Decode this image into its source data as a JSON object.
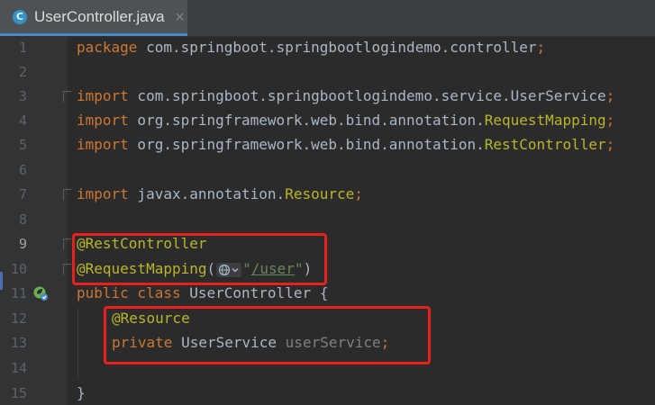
{
  "tab": {
    "icon_letter": "C",
    "title": "UserController.java",
    "close_glyph": "×"
  },
  "gutter": {
    "line_numbers": [
      "1",
      "2",
      "3",
      "4",
      "5",
      "6",
      "7",
      "8",
      "9",
      "10",
      "11",
      "12",
      "13",
      "14",
      "15"
    ]
  },
  "code": {
    "l1_kw": "package",
    "l1_rest": " com.springboot.springbootlogindemo.controller",
    "l1_semi": ";",
    "l3_kw": "import",
    "l3_pkg": " com.springboot.springbootlogindemo.service.",
    "l3_cls": "UserService",
    "l3_semi": ";",
    "l4_kw": "import",
    "l4_pkg": " org.springframework.web.bind.annotation.",
    "l4_cls": "RequestMapping",
    "l4_semi": ";",
    "l5_kw": "import",
    "l5_pkg": " org.springframework.web.bind.annotation.",
    "l5_cls": "RestController",
    "l5_semi": ";",
    "l7_kw": "import",
    "l7_pkg": " javax.annotation.",
    "l7_cls": "Resource",
    "l7_semi": ";",
    "l9_ann": "@RestController",
    "l10_ann": "@RequestMapping",
    "l10_open": "(",
    "l10_q1": "\"",
    "l10_path": "/user",
    "l10_q2": "\"",
    "l10_close": ")",
    "l11_kw": "public class",
    "l11_name": " UserController ",
    "l11_brace": "{",
    "l12_ann": "@Resource",
    "l13_kw": "private",
    "l13_type": " UserService ",
    "l13_field": "userService",
    "l13_semi": ";",
    "l15_brace": "}"
  },
  "icons": {
    "tab_icon": "java-class-icon",
    "run_icon": "spring-bean-icon",
    "globe_icon": "web-endpoint-icon",
    "chevron_icon": "chevron-down-icon"
  },
  "colors": {
    "background": "#2b2b2b",
    "keyword": "#cc7832",
    "annotation": "#bbb529",
    "string": "#6a8759",
    "highlight": "#e8201e"
  }
}
